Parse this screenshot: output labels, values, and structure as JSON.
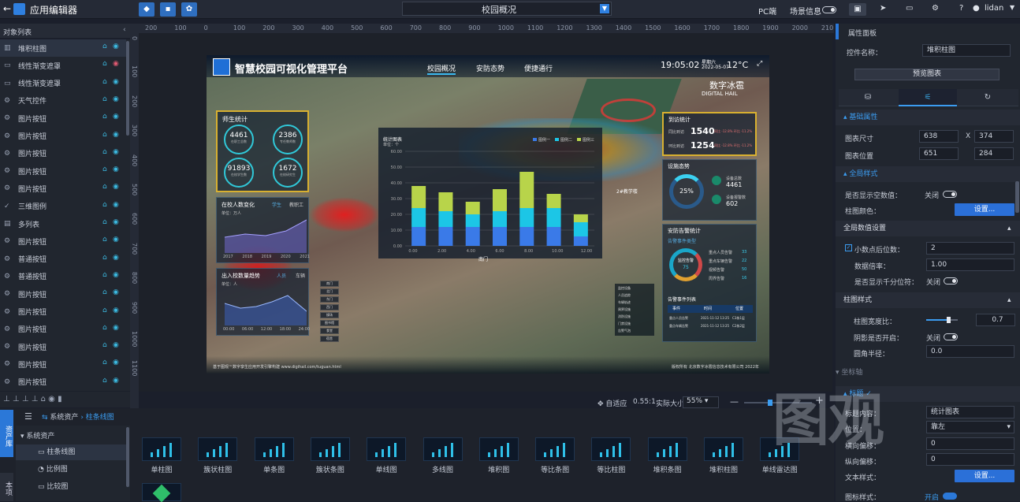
{
  "app": {
    "title": "应用编辑器",
    "page_select": "校园概况",
    "platform": "PC端",
    "scene_info": "场景信息",
    "user": "lidan"
  },
  "layers": {
    "header": "对象列表",
    "items": [
      {
        "label": "堆积柱图",
        "icon": "bar",
        "hidden": false,
        "selected": true
      },
      {
        "label": "线性渐变遮罩",
        "icon": "rect",
        "hidden": true
      },
      {
        "label": "线性渐变遮罩",
        "icon": "rect",
        "hidden": false
      },
      {
        "label": "天气控件",
        "icon": "gear",
        "hidden": false
      },
      {
        "label": "图片按钮",
        "icon": "gear",
        "hidden": false
      },
      {
        "label": "图片按钮",
        "icon": "gear",
        "hidden": false
      },
      {
        "label": "图片按钮",
        "icon": "gear",
        "hidden": false
      },
      {
        "label": "图片按钮",
        "icon": "gear",
        "hidden": false
      },
      {
        "label": "图片按钮",
        "icon": "gear",
        "hidden": false
      },
      {
        "label": "三维图例",
        "icon": "check",
        "hidden": false
      },
      {
        "label": "多列表",
        "icon": "table",
        "hidden": false
      },
      {
        "label": "图片按钮",
        "icon": "gear",
        "hidden": false
      },
      {
        "label": "普通按钮",
        "icon": "gear",
        "hidden": false
      },
      {
        "label": "普通按钮",
        "icon": "gear",
        "hidden": false
      },
      {
        "label": "图片按钮",
        "icon": "gear",
        "hidden": false
      },
      {
        "label": "图片按钮",
        "icon": "gear",
        "hidden": false
      },
      {
        "label": "图片按钮",
        "icon": "gear",
        "hidden": false
      },
      {
        "label": "图片按钮",
        "icon": "gear",
        "hidden": false
      },
      {
        "label": "图片按钮",
        "icon": "gear",
        "hidden": false
      },
      {
        "label": "图片按钮",
        "icon": "gear",
        "hidden": false
      }
    ]
  },
  "ruler": {
    "h": [
      "200",
      "100",
      "0",
      "100",
      "200",
      "300",
      "400",
      "500",
      "600",
      "700",
      "800",
      "900",
      "1000",
      "1100",
      "1200",
      "1300",
      "1400",
      "1500",
      "1600",
      "1700",
      "1800",
      "1900",
      "2000",
      "210"
    ],
    "v": [
      "0",
      "100",
      "200",
      "300",
      "400",
      "500",
      "600",
      "700",
      "800",
      "900",
      "1000",
      "1100"
    ]
  },
  "dashboard": {
    "title": "智慧校园可视化管理平台",
    "tabs": [
      "校园概况",
      "安防态势",
      "便捷通行"
    ],
    "time": "19:05:02",
    "weekday": "星期六",
    "date": "2022-05-07",
    "temp": "12°C",
    "brand": "数字冰雹",
    "brand_en": "DIGITAL HAIL",
    "teacher_title": "师生统计",
    "stats": [
      {
        "v": "4461",
        "l": "在职工总数"
      },
      {
        "v": "2386",
        "l": "专任教师数"
      },
      {
        "v": "91893",
        "l": "在校学生数"
      },
      {
        "v": "1672",
        "l": "在校研究生"
      }
    ],
    "trend_title": "在校人数变化",
    "trend_tabs": [
      "学生",
      "教职工"
    ],
    "trend_unit": "单位：万人",
    "trend_years": [
      "2017",
      "2018",
      "2019",
      "2020",
      "2021"
    ],
    "flow_title": "出入校数量趋势",
    "flow_tabs": [
      "人员",
      "车辆"
    ],
    "flow_unit": "单位：人",
    "flow_x": [
      "00:00",
      "06:00",
      "12:00",
      "18:00",
      "24:00"
    ],
    "chart_title": "统计图表",
    "chart_unit": "单位：个",
    "chart_legend": [
      "图例一",
      "图例二",
      "图例三"
    ],
    "chart_y": [
      "60.00",
      "50.00",
      "40.00",
      "30.00",
      "20.00",
      "10.00",
      "0.00"
    ],
    "chart_x": [
      "0.00",
      "2.00",
      "4.00",
      "6.00",
      "8.00",
      "10.00",
      "12.00"
    ],
    "visit_title": "到访统计",
    "visit_rows": [
      {
        "k": "同比到访",
        "v": "1540",
        "d": "同比 -12.8%  环比 -11.2%"
      },
      {
        "k": "环比到访",
        "v": "1254",
        "d": "同比 -12.8%  环比 -11.2%"
      }
    ],
    "fac_title": "设施态势",
    "fac_pct": "25%",
    "fac_items": [
      {
        "k": "设备总数",
        "v": "4461"
      },
      {
        "k": "设备报警数",
        "v": "602"
      }
    ],
    "sec_title": "安防告警统计",
    "sec_sub": "告警事件类型",
    "donut_center": "监控告警",
    "donut_val": "75",
    "alarm_types": [
      {
        "k": "重点人员告警",
        "v": "33"
      },
      {
        "k": "重点车辆告警",
        "v": "22"
      },
      {
        "k": "视频告警",
        "v": "50"
      },
      {
        "k": "周界告警",
        "v": "16"
      }
    ],
    "alarm_list_title": "告警事件列表",
    "alarm_cols": [
      "事件",
      "时间",
      "位置"
    ],
    "alarm_rows": [
      [
        "重点人员告警",
        "2021-11-12 13:25",
        "C3栋1层"
      ],
      [
        "重点车辆告警",
        "2021-11-12 13:25",
        "C2栋2层"
      ]
    ],
    "legend3d": [
      "监控设备",
      "人员追踪",
      "车辆轨迹",
      "周界设施",
      "消防设施",
      "门禁设施",
      "告警气泡"
    ],
    "map_buttons": [
      "南门",
      "北门",
      "东门",
      "西门",
      "操场",
      "图书馆",
      "食堂",
      "宿舍"
    ],
    "footer_left": "基于图观™数字孪生应用开发引擎构建 www.digihail.com/tuguan.html",
    "footer_right": "版权所有 北京数字冰雹信息技术有限公司 2022年",
    "map_label1": "南门",
    "map_label2": "2#教学楼"
  },
  "chart_data": {
    "type": "bar",
    "stacked": true,
    "title": "统计图表",
    "ylabel": "单位：个",
    "ylim": [
      0,
      60
    ],
    "series": [
      {
        "name": "图例一",
        "values": [
          12,
          12,
          12,
          12,
          12,
          12,
          6
        ]
      },
      {
        "name": "图例二",
        "values": [
          12,
          10,
          8,
          10,
          12,
          12,
          9
        ]
      },
      {
        "name": "图例三",
        "values": [
          14,
          12,
          8,
          14,
          23,
          9,
          5
        ]
      }
    ],
    "colors": [
      "#3a7ae8",
      "#1cc6e6",
      "#b8d44a"
    ]
  },
  "zoom": {
    "fit": "自适应",
    "ratio": "0.55:1",
    "actual": "实际大小",
    "value": "55%"
  },
  "assets": {
    "tab": "资产库",
    "tab2": "本项",
    "bread1": "系统资产",
    "bread2": "柱条线图",
    "tree_root": "系统资产",
    "tree": [
      "柱条线图",
      "比例图",
      "比较图"
    ],
    "thumbs": [
      "单柱图",
      "簇状柱图",
      "单条图",
      "簇状条图",
      "单线图",
      "多线图",
      "堆积图",
      "等比条图",
      "等比柱图",
      "堆积条图",
      "堆积柱图",
      "单线雷达图"
    ]
  },
  "props": {
    "header": "属性面板",
    "name_label": "控件名称：",
    "name_value": "堆积柱图",
    "preview": "预览图表",
    "basic": "基础属性",
    "size_label": "图表尺寸",
    "size_w": "638",
    "size_h": "374",
    "x_sep": "X",
    "pos_label": "图表位置",
    "pos_x": "651",
    "pos_y": "284",
    "global": "全局样式",
    "empty_label": "是否显示空数值：",
    "empty_val": "关闭",
    "color_label": "柱图颜色：",
    "settings": "设置...",
    "global_num": "全局数值设置",
    "decimals_label": "小数点后位数：",
    "decimals": "2",
    "ratio_label": "数据倍率：",
    "ratio": "1.00",
    "thousand_label": "是否显示千分位符：",
    "thousand_val": "关闭",
    "bar_style": "柱图样式",
    "width_label": "柱图宽度比：",
    "width_val": "0.7",
    "width_frac": 0.7,
    "shadow_label": "阴影是否开启：",
    "shadow_val": "关闭",
    "radius_label": "圆角半径：",
    "radius_val": "0.0",
    "axis": "坐标轴",
    "title_sec": "标题",
    "title_content_label": "标题内容：",
    "title_content": "统计图表",
    "position_label": "位置：",
    "position": "靠左",
    "hoff_label": "横向偏移：",
    "hoff": "0",
    "voff_label": "纵向偏移：",
    "voff": "0",
    "text_style_label": "文本样式：",
    "legend_label": "图标样式：",
    "legend_val": "开启"
  },
  "watermark": "图观"
}
